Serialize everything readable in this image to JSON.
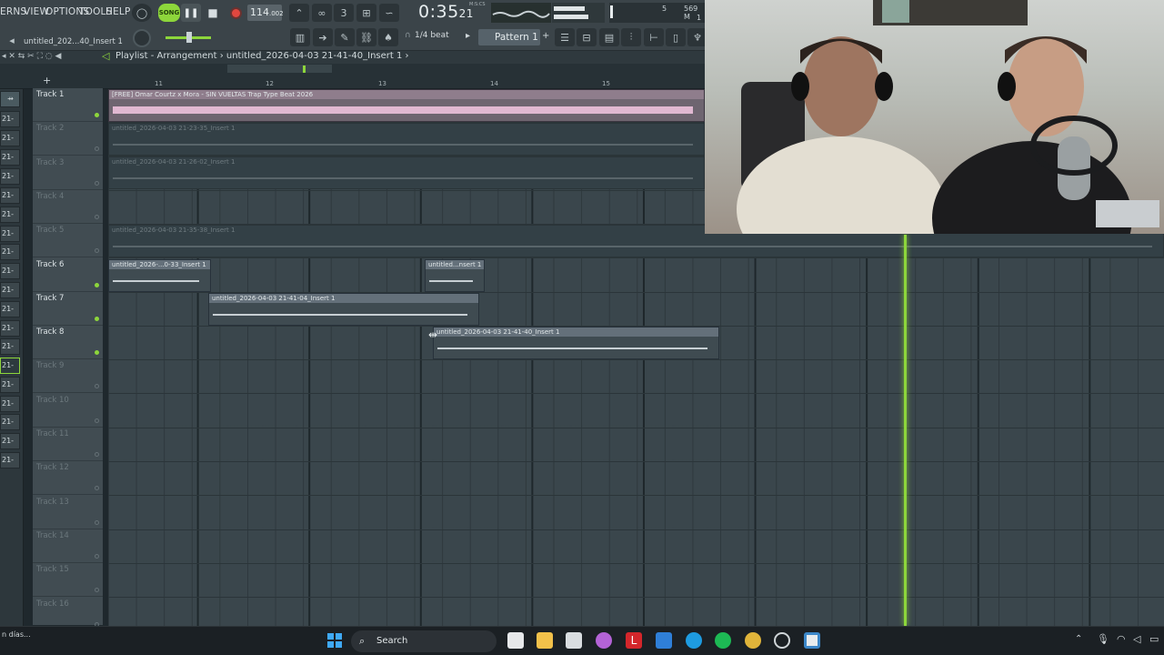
{
  "menu": [
    "ERNS",
    "VIEW",
    "OPTIONS",
    "TOOLS",
    "HELP"
  ],
  "transport": {
    "mode_label": "SONG",
    "tempo": "114",
    "tempo_decimal": ".002",
    "time_main": "0:35",
    "time_frac": "21",
    "time_unit": "M:S:CS",
    "cpu_value": "5",
    "memory": "569 M",
    "poly": "1"
  },
  "toolbar": {
    "song_file": "untitled_202...40_Insert 1",
    "snap": "1/4 beat",
    "pattern": "Pattern 1"
  },
  "playlist": {
    "title": "Playlist - Arrangement",
    "breadcrumb": "untitled_2026-04-03 21-41-40_Insert 1",
    "bars": [
      "11",
      "12",
      "13",
      "14",
      "15"
    ]
  },
  "picker_items": [
    "21-",
    "21-",
    "21-",
    "21-",
    "21-",
    "21-",
    "21-",
    "21-",
    "21-",
    "21-",
    "21-",
    "21-",
    "21-",
    "21-",
    "21-",
    "21-",
    "21-",
    "21-",
    "21-"
  ],
  "tracks": [
    {
      "name": "Track 1",
      "active": true
    },
    {
      "name": "Track 2",
      "active": false
    },
    {
      "name": "Track 3",
      "active": false
    },
    {
      "name": "Track 4",
      "active": false
    },
    {
      "name": "Track 5",
      "active": false
    },
    {
      "name": "Track 6",
      "active": true
    },
    {
      "name": "Track 7",
      "active": true
    },
    {
      "name": "Track 8",
      "active": true
    },
    {
      "name": "Track 9",
      "active": false
    },
    {
      "name": "Track 10",
      "active": false
    },
    {
      "name": "Track 11",
      "active": false
    },
    {
      "name": "Track 12",
      "active": false
    },
    {
      "name": "Track 13",
      "active": false
    },
    {
      "name": "Track 14",
      "active": false
    },
    {
      "name": "Track 15",
      "active": false
    },
    {
      "name": "Track 16",
      "active": false
    }
  ],
  "clips": {
    "c1": "[FREE] Omar Courtz x Mora - SIN VUELTAS Trap Type Beat 2026",
    "c2": "untitled_2026-04-03 21-23-35_Insert 1",
    "c3": "untitled_2026-04-03 21-26-02_Insert 1",
    "c4": "untitled_2026-04-03 21-35-38_Insert 1",
    "c5": "untitled_2026-...0-33_Insert 1",
    "c6": "untitled...nsert 1",
    "c7": "untitled_2026-04-03 21-41-04_Insert 1",
    "c8": "untitled_2026-04-03 21-41-40_Insert 1"
  },
  "taskbar": {
    "left_text": "n días...",
    "search": "Search"
  }
}
